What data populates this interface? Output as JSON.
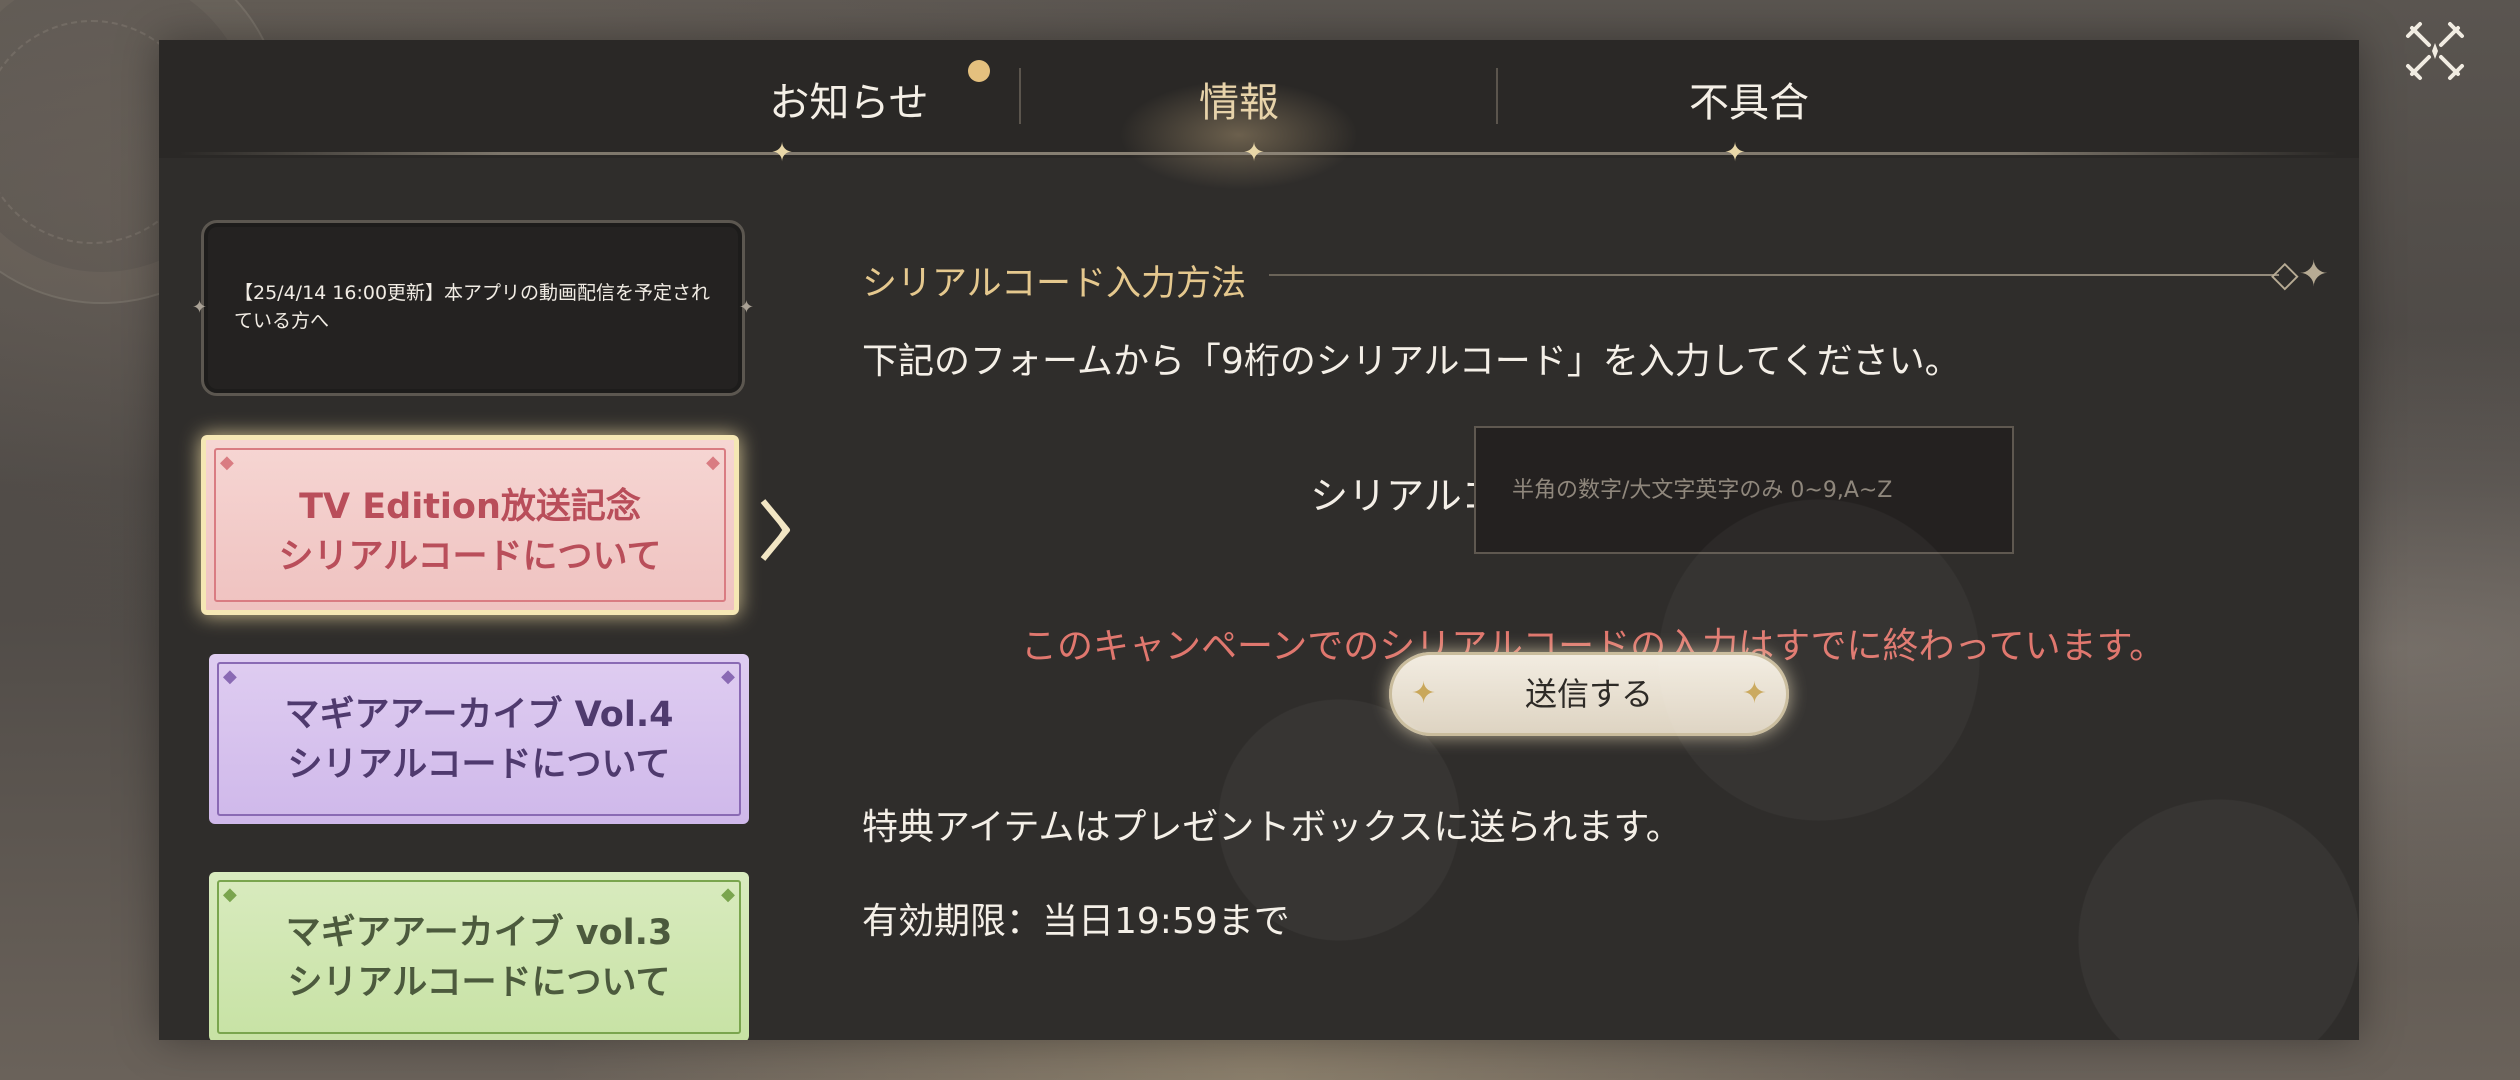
{
  "tabs": [
    {
      "label": "お知らせ",
      "active": false,
      "has_badge": true
    },
    {
      "label": "情報",
      "active": true,
      "has_badge": false
    },
    {
      "label": "不具合",
      "active": false,
      "has_badge": false
    }
  ],
  "sidebar": {
    "items": [
      {
        "text": "【25/4/14 16:00更新】本アプリの動画配信を予定されている方へ"
      },
      {
        "title_line1": "TV Edition放送記念",
        "title_line2": "シリアルコードについて",
        "selected": true
      },
      {
        "title_line1": "マギアアーカイブ Vol.4",
        "title_line2": "シリアルコードについて"
      },
      {
        "title_line1": "マギアアーカイブ vol.3",
        "title_line2": "シリアルコードについて"
      }
    ]
  },
  "content": {
    "section_title": "シリアルコード入力方法",
    "description": "下記のフォームから「9桁のシリアルコード」を入力してください。",
    "field_label": "シリアルコード",
    "field_placeholder": "半角の数字/大文字英字のみ 0~9,A~Z",
    "field_value": "",
    "error_message": "このキャンペーンでのシリアルコードの入力はすでに終わっています。",
    "submit_label": "送信する",
    "note_items": "特典アイテムはプレゼントボックスに送られます。",
    "note_expiry": "有効期限：当日19:59まで"
  },
  "colors": {
    "accent_gold": "#e5c88e",
    "error": "#e0776e",
    "tv_banner": "#f6d6d3",
    "magia4_banner": "#dfcdf1",
    "magia3_banner": "#d9ebbf"
  }
}
